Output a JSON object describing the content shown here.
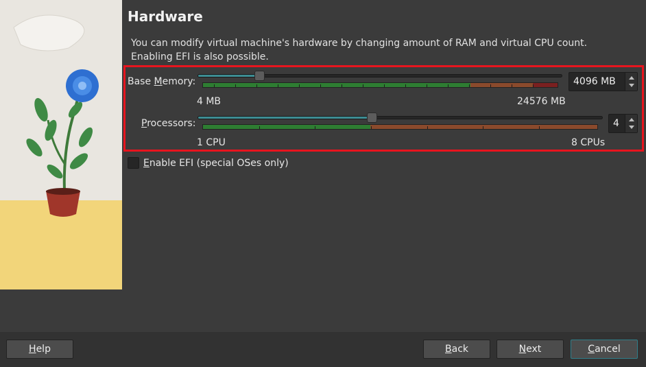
{
  "page": {
    "title": "Hardware",
    "description_line1": "You can modify virtual machine's hardware by changing amount of RAM and virtual CPU count.",
    "description_line2": "Enabling EFI is also possible."
  },
  "memory": {
    "label_pre": "Base ",
    "label_underlined": "M",
    "label_post": "emory:",
    "value": "4096 MB",
    "min_label": "4 MB",
    "max_label": "24576 MB",
    "level": 0.167
  },
  "processors": {
    "label_underlined": "P",
    "label_post": "rocessors:",
    "value": "4",
    "min_label": "1 CPU",
    "max_label": "8 CPUs",
    "level": 0.43
  },
  "efi": {
    "label_underlined": "E",
    "label_post": "nable EFI (special OSes only)",
    "checked": false
  },
  "buttons": {
    "help": {
      "underlined": "H",
      "rest": "elp"
    },
    "back": {
      "underlined": "B",
      "rest": "ack"
    },
    "next": {
      "underlined": "N",
      "rest": "ext"
    },
    "cancel": {
      "underlined": "C",
      "rest": "ancel"
    }
  },
  "colors": {
    "highlight": "#e8141e",
    "slider_fill": "#3d8d93",
    "meter_green": "#2e7d32",
    "meter_orange": "#8a4a2c",
    "meter_red": "#7a2020"
  },
  "icons": {
    "illustration": "flower-pot-illustration",
    "spin_up": "arrow-up-icon",
    "spin_down": "arrow-down-icon"
  }
}
